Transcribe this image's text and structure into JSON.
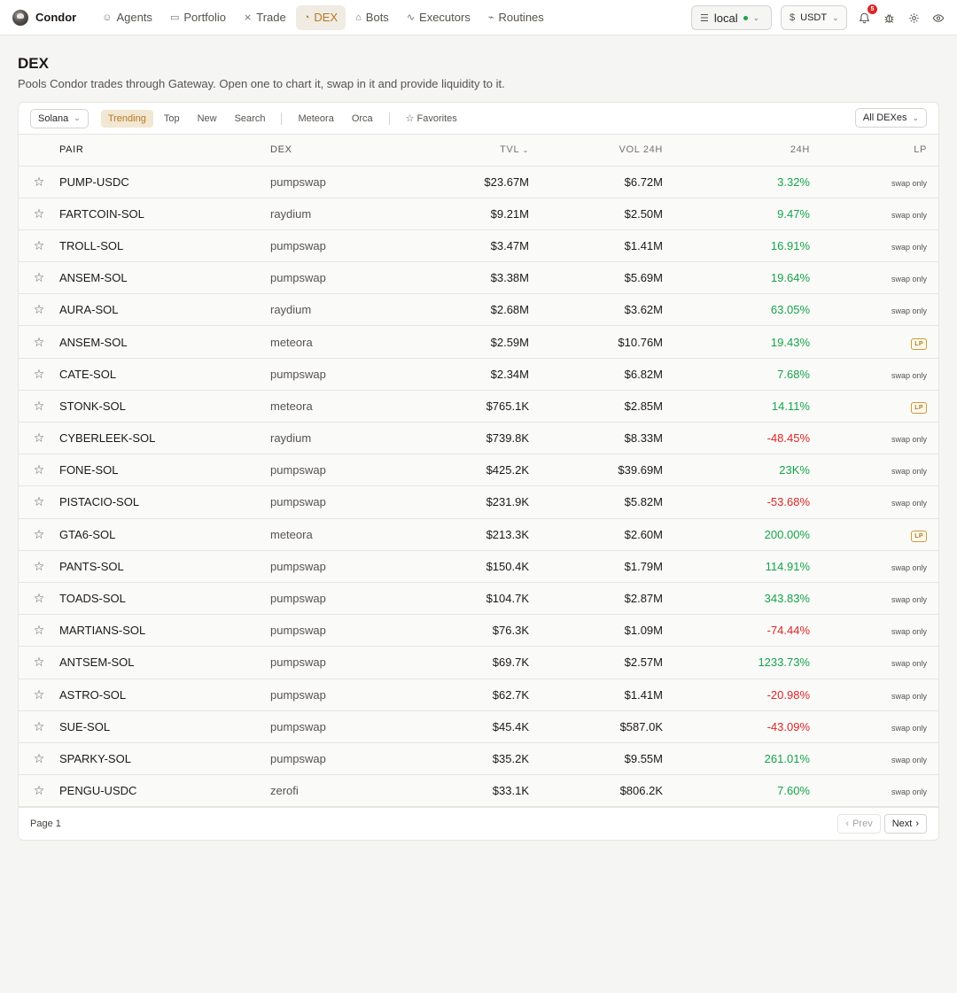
{
  "app": {
    "name": "Condor"
  },
  "nav": [
    {
      "label": "Agents",
      "icon": "agents-icon",
      "glyph": "☺",
      "active": false
    },
    {
      "label": "Portfolio",
      "icon": "portfolio-icon",
      "glyph": "▭",
      "active": false
    },
    {
      "label": "Trade",
      "icon": "trade-icon",
      "glyph": "⨯",
      "active": false
    },
    {
      "label": "DEX",
      "icon": "dex-icon",
      "glyph": "◔",
      "active": true
    },
    {
      "label": "Bots",
      "icon": "bots-icon",
      "glyph": "⌂",
      "active": false
    },
    {
      "label": "Executors",
      "icon": "executors-icon",
      "glyph": "∿",
      "active": false
    },
    {
      "label": "Routines",
      "icon": "routines-icon",
      "glyph": "⌁",
      "active": false
    }
  ],
  "topbar": {
    "environment": "local",
    "currency": "USDT",
    "notifications_count": "5"
  },
  "page": {
    "title": "DEX",
    "subtitle": "Pools Condor trades through Gateway. Open one to chart it, swap in it and provide liquidity to it."
  },
  "toolbar": {
    "network": "Solana",
    "filters": [
      {
        "label": "Trending",
        "active": true
      },
      {
        "label": "Top",
        "active": false
      },
      {
        "label": "New",
        "active": false
      },
      {
        "label": "Search",
        "active": false
      }
    ],
    "dex_filters": [
      "Meteora",
      "Orca"
    ],
    "favorites": "Favorites",
    "dex_select": "All DEXes"
  },
  "table": {
    "headers": {
      "pair": "PAIR",
      "dex": "DEX",
      "tvl": "TVL",
      "vol": "VOL 24H",
      "change": "24H",
      "lp": "LP"
    },
    "rows": [
      {
        "pair": "PUMP-USDC",
        "dex": "pumpswap",
        "tvl": "$23.67M",
        "vol": "$6.72M",
        "change": "3.32%",
        "dir": "pos",
        "lp": "swap only"
      },
      {
        "pair": "FARTCOIN-SOL",
        "dex": "raydium",
        "tvl": "$9.21M",
        "vol": "$2.50M",
        "change": "9.47%",
        "dir": "pos",
        "lp": "swap only"
      },
      {
        "pair": "TROLL-SOL",
        "dex": "pumpswap",
        "tvl": "$3.47M",
        "vol": "$1.41M",
        "change": "16.91%",
        "dir": "pos",
        "lp": "swap only"
      },
      {
        "pair": "ANSEM-SOL",
        "dex": "pumpswap",
        "tvl": "$3.38M",
        "vol": "$5.69M",
        "change": "19.64%",
        "dir": "pos",
        "lp": "swap only"
      },
      {
        "pair": "AURA-SOL",
        "dex": "raydium",
        "tvl": "$2.68M",
        "vol": "$3.62M",
        "change": "63.05%",
        "dir": "pos",
        "lp": "swap only"
      },
      {
        "pair": "ANSEM-SOL",
        "dex": "meteora",
        "tvl": "$2.59M",
        "vol": "$10.76M",
        "change": "19.43%",
        "dir": "pos",
        "lp": "LP"
      },
      {
        "pair": "CATE-SOL",
        "dex": "pumpswap",
        "tvl": "$2.34M",
        "vol": "$6.82M",
        "change": "7.68%",
        "dir": "pos",
        "lp": "swap only"
      },
      {
        "pair": "STONK-SOL",
        "dex": "meteora",
        "tvl": "$765.1K",
        "vol": "$2.85M",
        "change": "14.11%",
        "dir": "pos",
        "lp": "LP"
      },
      {
        "pair": "CYBERLEEK-SOL",
        "dex": "raydium",
        "tvl": "$739.8K",
        "vol": "$8.33M",
        "change": "-48.45%",
        "dir": "neg",
        "lp": "swap only"
      },
      {
        "pair": "FONE-SOL",
        "dex": "pumpswap",
        "tvl": "$425.2K",
        "vol": "$39.69M",
        "change": "23K%",
        "dir": "pos",
        "lp": "swap only"
      },
      {
        "pair": "PISTACIO-SOL",
        "dex": "pumpswap",
        "tvl": "$231.9K",
        "vol": "$5.82M",
        "change": "-53.68%",
        "dir": "neg",
        "lp": "swap only"
      },
      {
        "pair": "GTA6-SOL",
        "dex": "meteora",
        "tvl": "$213.3K",
        "vol": "$2.60M",
        "change": "200.00%",
        "dir": "pos",
        "lp": "LP"
      },
      {
        "pair": "PANTS-SOL",
        "dex": "pumpswap",
        "tvl": "$150.4K",
        "vol": "$1.79M",
        "change": "114.91%",
        "dir": "pos",
        "lp": "swap only"
      },
      {
        "pair": "TOADS-SOL",
        "dex": "pumpswap",
        "tvl": "$104.7K",
        "vol": "$2.87M",
        "change": "343.83%",
        "dir": "pos",
        "lp": "swap only"
      },
      {
        "pair": "MARTIANS-SOL",
        "dex": "pumpswap",
        "tvl": "$76.3K",
        "vol": "$1.09M",
        "change": "-74.44%",
        "dir": "neg",
        "lp": "swap only"
      },
      {
        "pair": "ANTSEM-SOL",
        "dex": "pumpswap",
        "tvl": "$69.7K",
        "vol": "$2.57M",
        "change": "1233.73%",
        "dir": "pos",
        "lp": "swap only"
      },
      {
        "pair": "ASTRO-SOL",
        "dex": "pumpswap",
        "tvl": "$62.7K",
        "vol": "$1.41M",
        "change": "-20.98%",
        "dir": "neg",
        "lp": "swap only"
      },
      {
        "pair": "SUE-SOL",
        "dex": "pumpswap",
        "tvl": "$45.4K",
        "vol": "$587.0K",
        "change": "-43.09%",
        "dir": "neg",
        "lp": "swap only"
      },
      {
        "pair": "SPARKY-SOL",
        "dex": "pumpswap",
        "tvl": "$35.2K",
        "vol": "$9.55M",
        "change": "261.01%",
        "dir": "pos",
        "lp": "swap only"
      },
      {
        "pair": "PENGU-USDC",
        "dex": "zerofi",
        "tvl": "$33.1K",
        "vol": "$806.2K",
        "change": "7.60%",
        "dir": "pos",
        "lp": "swap only"
      }
    ]
  },
  "footer": {
    "page": "Page 1",
    "prev": "Prev",
    "next": "Next"
  },
  "colors": {
    "accent": "#b7791f",
    "positive": "#16a34a",
    "negative": "#dc2626"
  }
}
